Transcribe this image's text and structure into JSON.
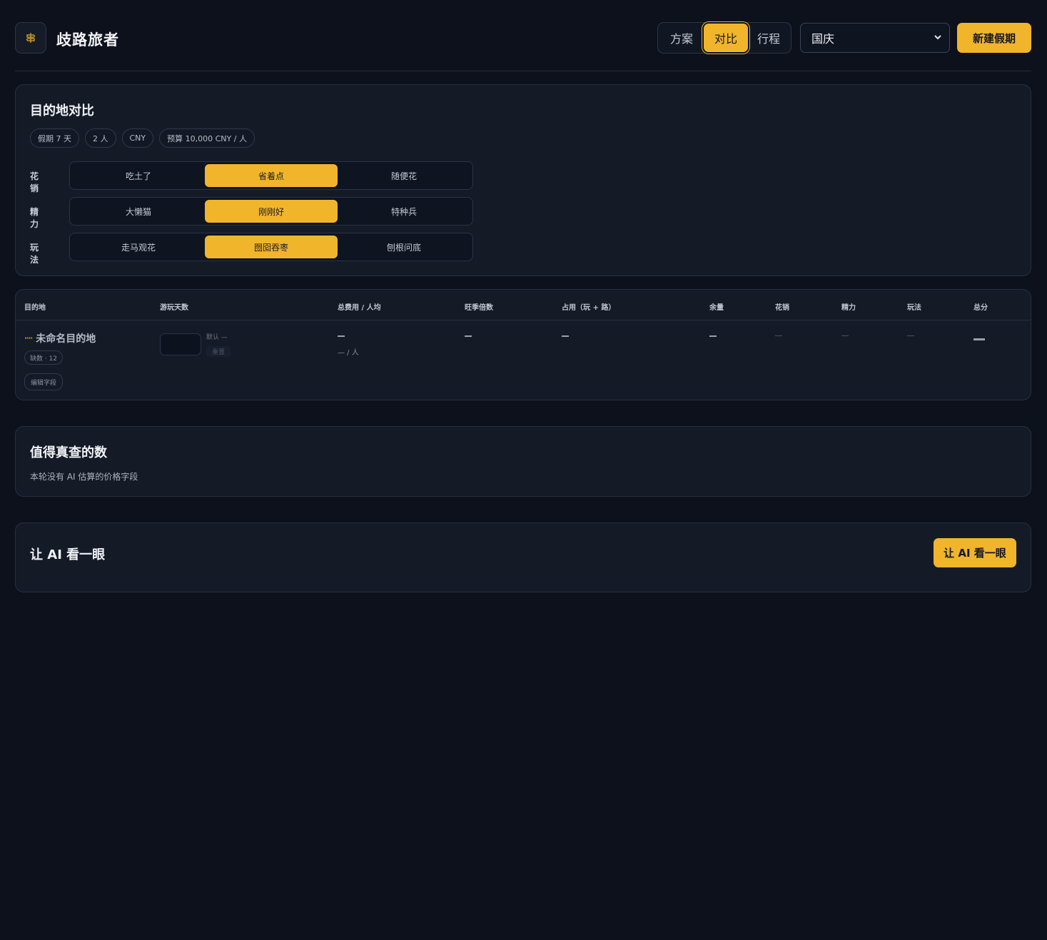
{
  "app": {
    "title": "歧路旅者"
  },
  "header": {
    "view_tabs": [
      "方案",
      "对比",
      "行程"
    ],
    "active_tab": "对比",
    "holiday_select": {
      "selected": "国庆"
    },
    "new_holiday_label": "新建假期"
  },
  "compare": {
    "title": "目的地对比",
    "chips": [
      "假期 7 天",
      "2 人",
      "CNY",
      "预算 10,000 CNY / 人"
    ],
    "prefs": [
      {
        "label": "花销",
        "options": [
          "吃土了",
          "省着点",
          "随便花"
        ],
        "selected": "省着点"
      },
      {
        "label": "精力",
        "options": [
          "大懒猫",
          "刚刚好",
          "特种兵"
        ],
        "selected": "刚刚好"
      },
      {
        "label": "玩法",
        "options": [
          "走马观花",
          "囫囵吞枣",
          "刨根问底"
        ],
        "selected": "囫囵吞枣"
      }
    ]
  },
  "table": {
    "headers": [
      "目的地",
      "游玩天数",
      "总费用 / 人均",
      "旺季倍数",
      "占用（玩 + 路）",
      "余量",
      "花销",
      "精力",
      "玩法",
      "总分"
    ],
    "rows": [
      {
        "name": "未命名目的地",
        "missing_badge": "缺数 · 12",
        "edit_label": "编辑字段",
        "default_label": "默认 —",
        "reset_label": "重置",
        "per_person": "— / 人"
      }
    ]
  },
  "check": {
    "title": "值得真查的数",
    "text": "本轮没有 AI 估算的价格字段"
  },
  "ai": {
    "title": "让 AI 看一眼",
    "button_label": "让 AI 看一眼"
  },
  "colors": {
    "accent": "#f1b52c",
    "background": "#0c111c",
    "card": "#141b27"
  }
}
